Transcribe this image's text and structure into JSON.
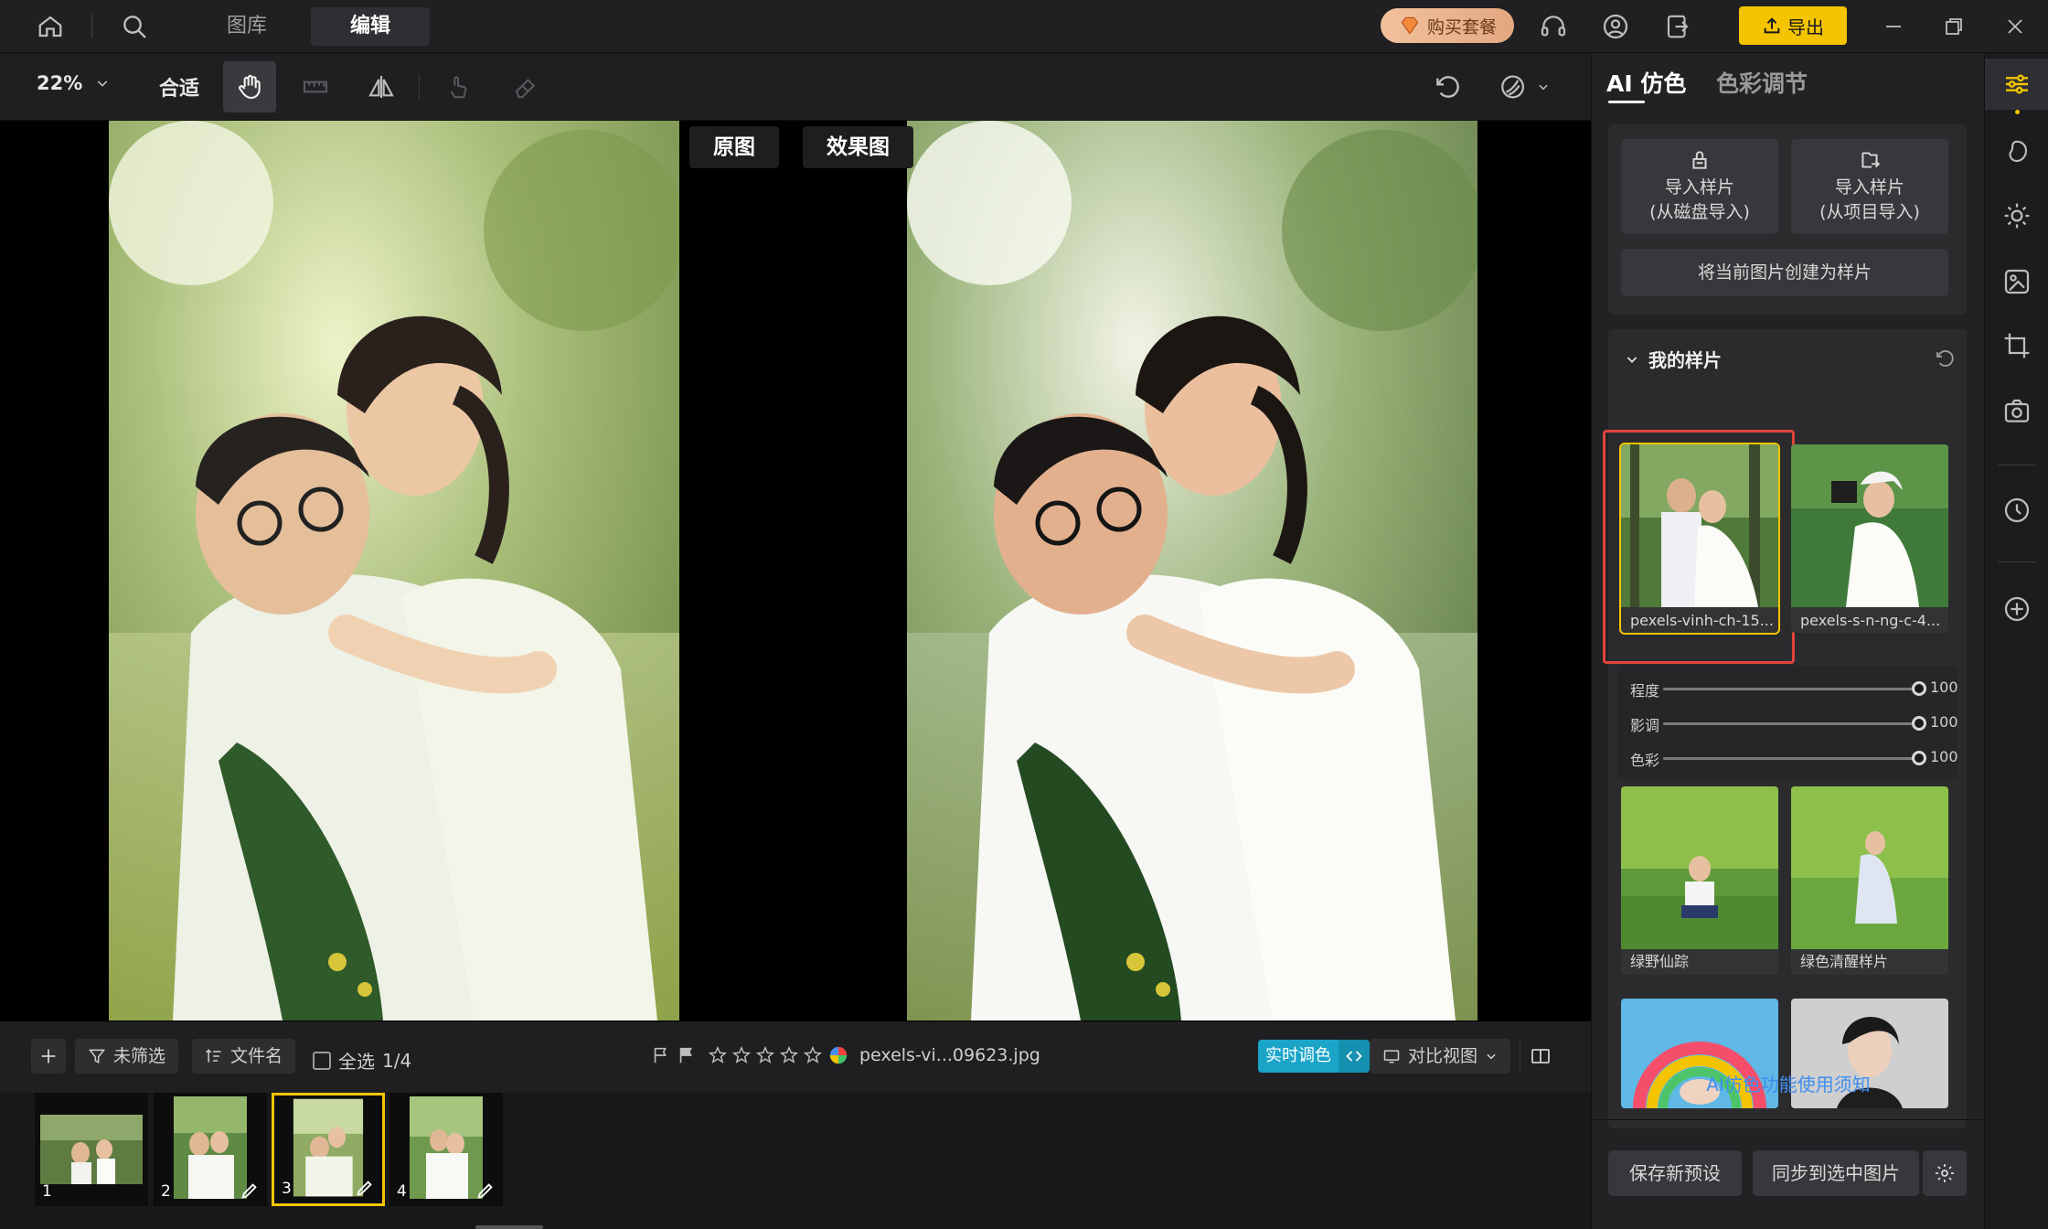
{
  "topbar": {
    "tabs": [
      {
        "label": "图库"
      },
      {
        "label": "编辑"
      }
    ],
    "buy_label": "购买套餐",
    "export_label": "导出"
  },
  "toolbar": {
    "zoom": "22%",
    "fit_label": "合适"
  },
  "canvas": {
    "original_label": "原图",
    "effect_label": "效果图"
  },
  "bottombar": {
    "filter_label": "未筛选",
    "sort_label": "文件名",
    "select_all_label": "全选",
    "selection_count": "1/4",
    "rating": 0,
    "filename": "pexels-vi...09623.jpg",
    "realtime_label": "实时调色",
    "compare_label": "对比视图"
  },
  "filmstrip": {
    "thumbs": [
      {
        "num": "1"
      },
      {
        "num": "2"
      },
      {
        "num": "3"
      },
      {
        "num": "4"
      }
    ],
    "selected_index": 2
  },
  "panel": {
    "tabs": [
      {
        "label": "AI 仿色"
      },
      {
        "label": "色彩调节"
      }
    ],
    "import_disk": {
      "line1": "导入样片",
      "line2": "(从磁盘导入)"
    },
    "import_project": {
      "line1": "导入样片",
      "line2": "(从项目导入)"
    },
    "create_sample": "将当前图片创建为样片",
    "my_samples_title": "我的样片",
    "samples": [
      {
        "name": "pexels-vinh-ch-15..."
      },
      {
        "name": "pexels-s-n-ng-c-4..."
      },
      {
        "name": "绿野仙踪"
      },
      {
        "name": "绿色清醒样片"
      },
      {
        "name": ""
      },
      {
        "name": ""
      }
    ],
    "sliders": [
      {
        "label": "程度",
        "value": 100
      },
      {
        "label": "影调",
        "value": 100
      },
      {
        "label": "色彩",
        "value": 100
      }
    ],
    "help_link": "AI仿色功能使用须知",
    "save_preset": "保存新预设",
    "sync_label": "同步到选中图片"
  },
  "colors": {
    "accent_yellow": "#f4c400",
    "highlight_red": "#e0443a",
    "link_blue": "#3f8ef0",
    "realtime_cyan": "#1aa4c8"
  }
}
